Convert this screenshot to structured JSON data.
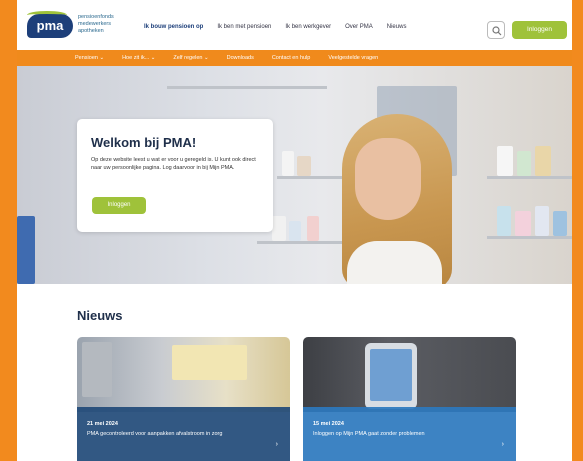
{
  "brand": {
    "logo_text": "pma",
    "tagline": "pensioenfonds medewerkers apotheken",
    "colors": {
      "navy": "#1d3f7a",
      "green": "#9fc23a",
      "orange": "#f08a1c"
    }
  },
  "nav": {
    "items": [
      {
        "label": "Ik bouw pensioen op",
        "active": true
      },
      {
        "label": "Ik ben met pensioen"
      },
      {
        "label": "Ik ben werkgever"
      },
      {
        "label": "Over PMA"
      },
      {
        "label": "Nieuws"
      }
    ],
    "search_icon": "search-icon",
    "login_label": "Inloggen"
  },
  "menu": {
    "items": [
      "Pensioen ⌄",
      "Hoe zit ik... ⌄",
      "Zelf regelen ⌄",
      "Downloads",
      "Contact en hulp",
      "Veelgestelde vragen"
    ]
  },
  "hero": {
    "title": "Welkom bij PMA!",
    "text": "Op deze website leest u wat er voor u geregeld is. U kunt ook direct naar uw persoonlijke pagina. Log daarvoor in bij Mijn PMA.",
    "button_label": "Inloggen"
  },
  "news": {
    "heading": "Nieuws",
    "items": [
      {
        "date": "21 mei 2024",
        "title": "PMA gecontroleerd voor aanpakken afvalstroom in zorg",
        "arrow": "›"
      },
      {
        "date": "15 mei 2024",
        "title": "Inloggen op Mijn PMA gaat zonder problemen",
        "arrow": "›"
      }
    ]
  }
}
